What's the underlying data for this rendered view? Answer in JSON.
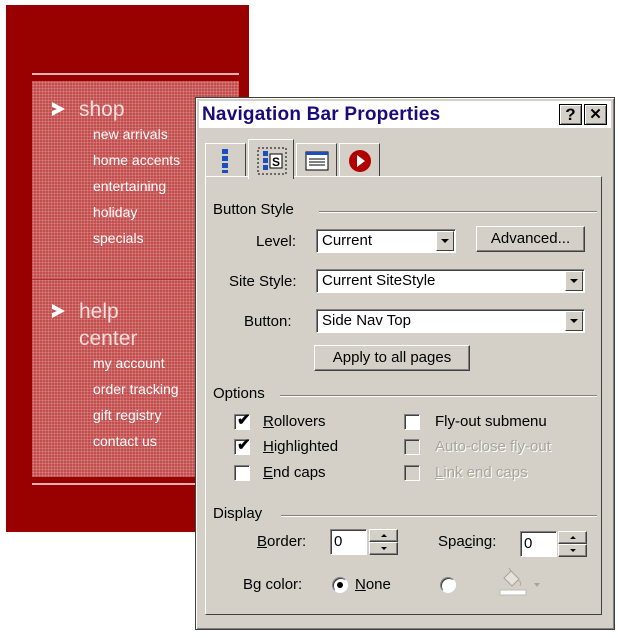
{
  "background_nav": {
    "shop": {
      "heading": "shop",
      "links": [
        "new arrivals",
        "home accents",
        "entertaining",
        "holiday",
        "specials"
      ]
    },
    "help": {
      "heading_line1": "help",
      "heading_line2": "center",
      "links": [
        "my account",
        "order tracking",
        "gift registry",
        "contact us"
      ]
    }
  },
  "dialog": {
    "title": "Navigation Bar Properties",
    "help_glyph": "?",
    "close_glyph": "✕",
    "tabs": [
      {
        "icon": "vertical-bars-icon"
      },
      {
        "icon": "style-icon",
        "active": true
      },
      {
        "icon": "page-icon"
      },
      {
        "icon": "record-icon"
      }
    ],
    "button_style": {
      "group_label": "Button Style",
      "level_label": "Level:",
      "level_value": "Current",
      "advanced_label": "Advanced...",
      "site_style_label": "Site Style:",
      "site_style_value": "Current SiteStyle",
      "button_label": "Button:",
      "button_value": "Side Nav Top",
      "apply_label": "Apply to all pages"
    },
    "options": {
      "group_label": "Options",
      "rollovers": {
        "accel": "R",
        "rest": "ollovers",
        "checked": true
      },
      "highlighted": {
        "accel": "H",
        "rest": "ighlighted",
        "checked": true
      },
      "end_caps": {
        "accel": "E",
        "rest": "nd caps",
        "checked": false
      },
      "flyout_submenu": {
        "label": "Fly-out submenu",
        "checked": false
      },
      "auto_close_flyout": {
        "label": "Auto-close fly-out",
        "enabled": false
      },
      "link_end_caps": {
        "accel": "L",
        "rest": "ink end caps",
        "enabled": false
      }
    },
    "display": {
      "group_label": "Display",
      "border": {
        "accel": "B",
        "rest": "order:",
        "value": "0"
      },
      "spacing": {
        "pre": "Spa",
        "accel": "c",
        "rest": "ing:",
        "value": "0"
      },
      "bg_color_label": "Bg color:",
      "none": {
        "accel": "N",
        "rest": "one",
        "selected": true
      },
      "custom_color": "#ffffff"
    }
  }
}
